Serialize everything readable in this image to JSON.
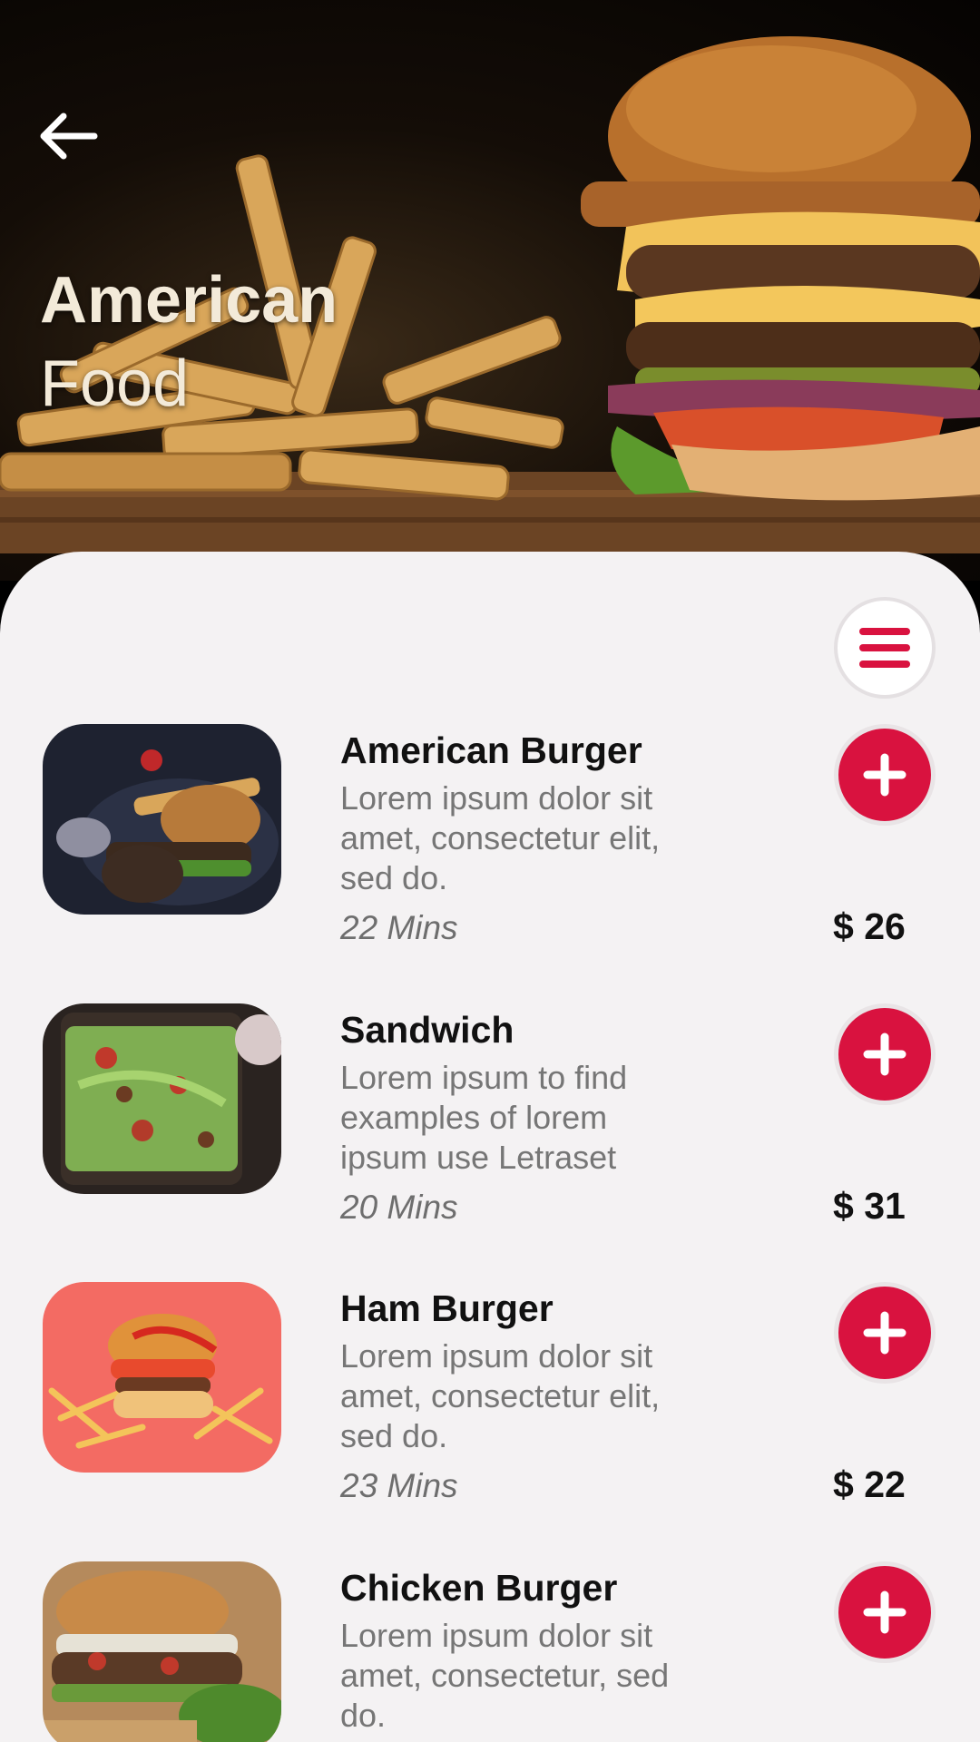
{
  "header": {
    "back_icon": "arrow-left-icon",
    "title_line1": "American",
    "title_line2": "Food"
  },
  "menu": {
    "icon": "hamburger-menu-icon"
  },
  "colors": {
    "accent": "#d9123f",
    "sheet": "#f4f2f3",
    "text": "#111111",
    "muted": "#767676"
  },
  "items": [
    {
      "name": "American Burger",
      "desc": "Lorem ipsum dolor sit amet, consectetur elit, sed do.",
      "time": "22 Mins",
      "price": "$ 26"
    },
    {
      "name": "Sandwich",
      "desc": "Lorem ipsum   to find examples of lorem ipsum  use  Letraset",
      "time": "20 Mins",
      "price": "$ 31"
    },
    {
      "name": "Ham Burger",
      "desc": "Lorem ipsum dolor sit amet, consectetur elit, sed do.",
      "time": "23 Mins",
      "price": "$ 22"
    },
    {
      "name": "Chicken Burger",
      "desc": "Lorem ipsum dolor sit amet, consectetur, sed do.",
      "time": "",
      "price": ""
    }
  ]
}
